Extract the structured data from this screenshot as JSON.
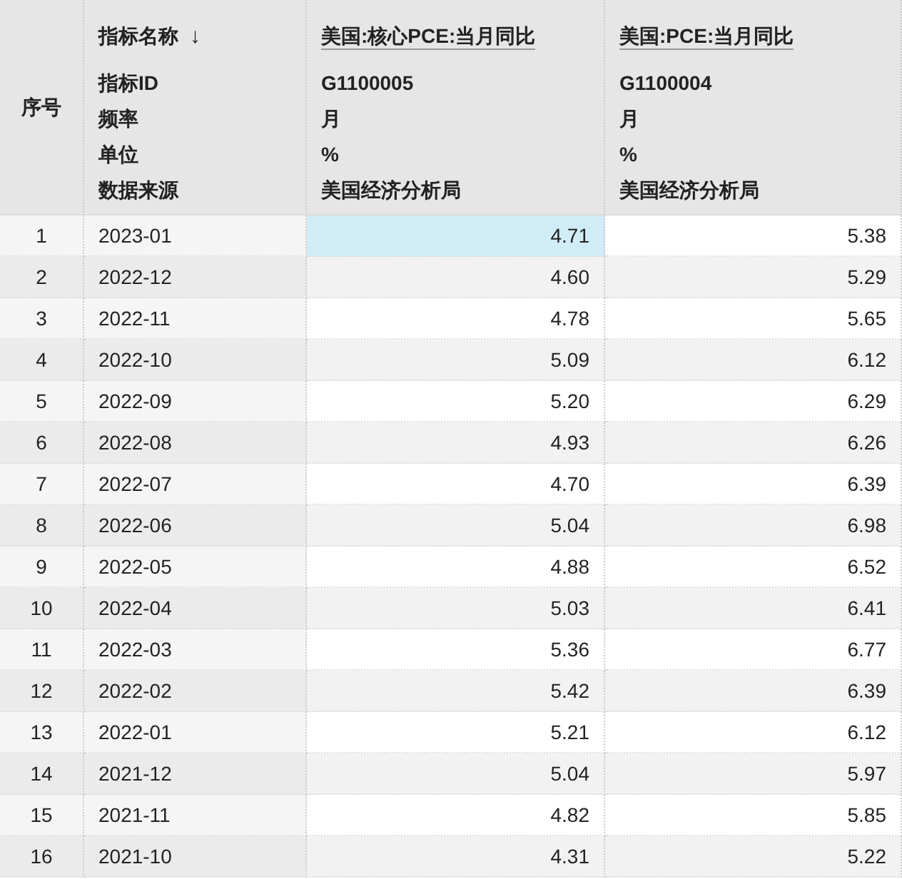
{
  "header": {
    "index_label": "序号",
    "field_labels": {
      "name": "指标名称",
      "sort_arrow": "↓",
      "id": "指标ID",
      "frequency": "频率",
      "unit": "单位",
      "source": "数据来源"
    },
    "series": [
      {
        "name": "美国:核心PCE:当月同比",
        "id": "G1100005",
        "frequency": "月",
        "unit": "%",
        "source": "美国经济分析局"
      },
      {
        "name": "美国:PCE:当月同比",
        "id": "G1100004",
        "frequency": "月",
        "unit": "%",
        "source": "美国经济分析局"
      }
    ]
  },
  "rows": [
    {
      "index": "1",
      "date": "2023-01",
      "values": [
        {
          "text": "4.71",
          "selected": true
        },
        {
          "text": "5.38",
          "selected": false
        }
      ]
    },
    {
      "index": "2",
      "date": "2022-12",
      "values": [
        {
          "text": "4.60",
          "selected": false
        },
        {
          "text": "5.29",
          "selected": false
        }
      ]
    },
    {
      "index": "3",
      "date": "2022-11",
      "values": [
        {
          "text": "4.78",
          "selected": false
        },
        {
          "text": "5.65",
          "selected": false
        }
      ]
    },
    {
      "index": "4",
      "date": "2022-10",
      "values": [
        {
          "text": "5.09",
          "selected": false
        },
        {
          "text": "6.12",
          "selected": false
        }
      ]
    },
    {
      "index": "5",
      "date": "2022-09",
      "values": [
        {
          "text": "5.20",
          "selected": false
        },
        {
          "text": "6.29",
          "selected": false
        }
      ]
    },
    {
      "index": "6",
      "date": "2022-08",
      "values": [
        {
          "text": "4.93",
          "selected": false
        },
        {
          "text": "6.26",
          "selected": false
        }
      ]
    },
    {
      "index": "7",
      "date": "2022-07",
      "values": [
        {
          "text": "4.70",
          "selected": false
        },
        {
          "text": "6.39",
          "selected": false
        }
      ]
    },
    {
      "index": "8",
      "date": "2022-06",
      "values": [
        {
          "text": "5.04",
          "selected": false
        },
        {
          "text": "6.98",
          "selected": false
        }
      ]
    },
    {
      "index": "9",
      "date": "2022-05",
      "values": [
        {
          "text": "4.88",
          "selected": false
        },
        {
          "text": "6.52",
          "selected": false
        }
      ]
    },
    {
      "index": "10",
      "date": "2022-04",
      "values": [
        {
          "text": "5.03",
          "selected": false
        },
        {
          "text": "6.41",
          "selected": false
        }
      ]
    },
    {
      "index": "11",
      "date": "2022-03",
      "values": [
        {
          "text": "5.36",
          "selected": false
        },
        {
          "text": "6.77",
          "selected": false
        }
      ]
    },
    {
      "index": "12",
      "date": "2022-02",
      "values": [
        {
          "text": "5.42",
          "selected": false
        },
        {
          "text": "6.39",
          "selected": false
        }
      ]
    },
    {
      "index": "13",
      "date": "2022-01",
      "values": [
        {
          "text": "5.21",
          "selected": false
        },
        {
          "text": "6.12",
          "selected": false
        }
      ]
    },
    {
      "index": "14",
      "date": "2021-12",
      "values": [
        {
          "text": "5.04",
          "selected": false
        },
        {
          "text": "5.97",
          "selected": false
        }
      ]
    },
    {
      "index": "15",
      "date": "2021-11",
      "values": [
        {
          "text": "4.82",
          "selected": false
        },
        {
          "text": "5.85",
          "selected": false
        }
      ]
    },
    {
      "index": "16",
      "date": "2021-10",
      "values": [
        {
          "text": "4.31",
          "selected": false
        },
        {
          "text": "5.22",
          "selected": false
        }
      ]
    }
  ]
}
